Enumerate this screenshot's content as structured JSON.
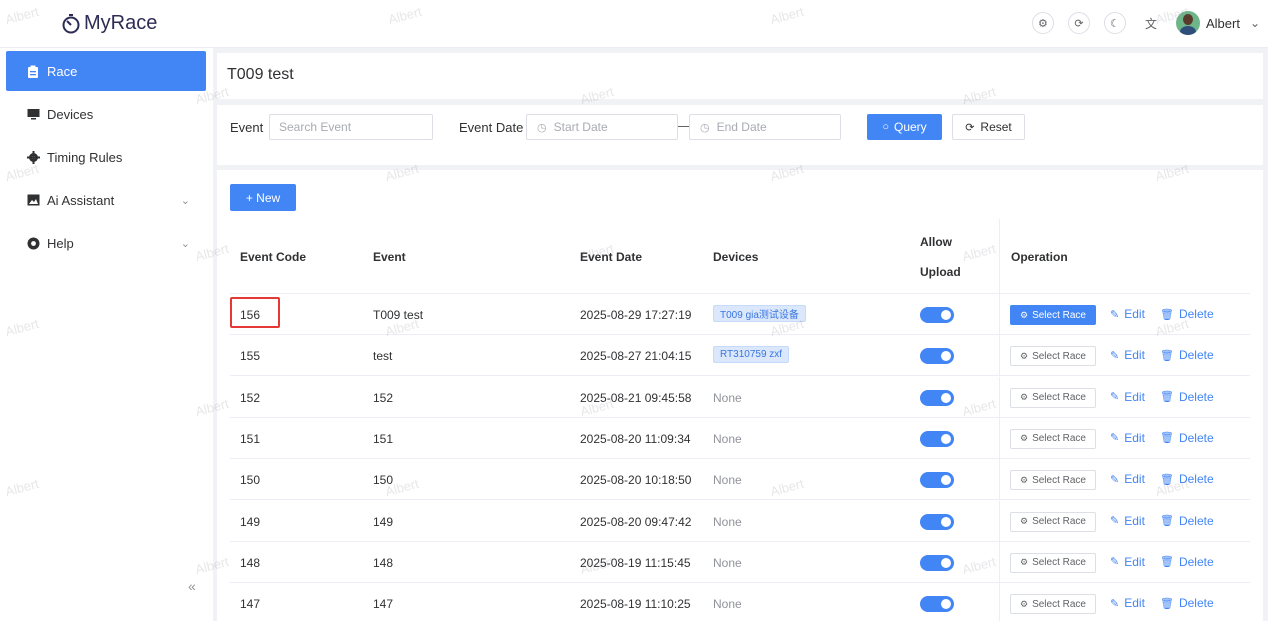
{
  "header": {
    "logo": "MyRace",
    "user_name": "Albert",
    "icons": [
      "settings-icon",
      "refresh-icon",
      "dark-mode-icon",
      "translate-icon"
    ]
  },
  "sidebar": {
    "items": [
      {
        "label": "Race",
        "icon": "clipboard-icon",
        "active": true
      },
      {
        "label": "Devices",
        "icon": "monitor-icon"
      },
      {
        "label": "Timing Rules",
        "icon": "gear-icon"
      },
      {
        "label": "Ai Assistant",
        "icon": "image-icon",
        "expandable": true
      },
      {
        "label": "Help",
        "icon": "help-icon",
        "expandable": true
      }
    ],
    "collapse_label": "«"
  },
  "page_title": "T009 test",
  "filter": {
    "event_label": "Event",
    "event_placeholder": "Search Event",
    "date_label": "Event Date",
    "start_placeholder": "Start Date",
    "end_placeholder": "End Date",
    "query_label": "Query",
    "reset_label": "Reset"
  },
  "table": {
    "new_label": "+ New",
    "columns": {
      "code": "Event Code",
      "event": "Event",
      "date": "Event Date",
      "devices": "Devices",
      "allow_1": "Allow",
      "allow_2": "Upload",
      "operation": "Operation"
    },
    "actions": {
      "select": "Select Race",
      "edit": "Edit",
      "delete": "Delete"
    },
    "rows": [
      {
        "code": "156",
        "event": "T009 test",
        "date": "2025-08-29 17:27:19",
        "devices": "T009 gia测试设备",
        "device_tag": true,
        "selected": true
      },
      {
        "code": "155",
        "event": "test",
        "date": "2025-08-27 21:04:15",
        "devices": "RT310759 zxf",
        "device_tag": true
      },
      {
        "code": "152",
        "event": "152",
        "date": "2025-08-21 09:45:58",
        "devices": "None"
      },
      {
        "code": "151",
        "event": "151",
        "date": "2025-08-20 11:09:34",
        "devices": "None"
      },
      {
        "code": "150",
        "event": "150",
        "date": "2025-08-20 10:18:50",
        "devices": "None"
      },
      {
        "code": "149",
        "event": "149",
        "date": "2025-08-20 09:47:42",
        "devices": "None"
      },
      {
        "code": "148",
        "event": "148",
        "date": "2025-08-19 11:15:45",
        "devices": "None"
      },
      {
        "code": "147",
        "event": "147",
        "date": "2025-08-19 11:10:25",
        "devices": "None"
      }
    ]
  },
  "watermark": "Albert",
  "colors": {
    "primary": "#4285f4",
    "highlight": "#e53935"
  }
}
